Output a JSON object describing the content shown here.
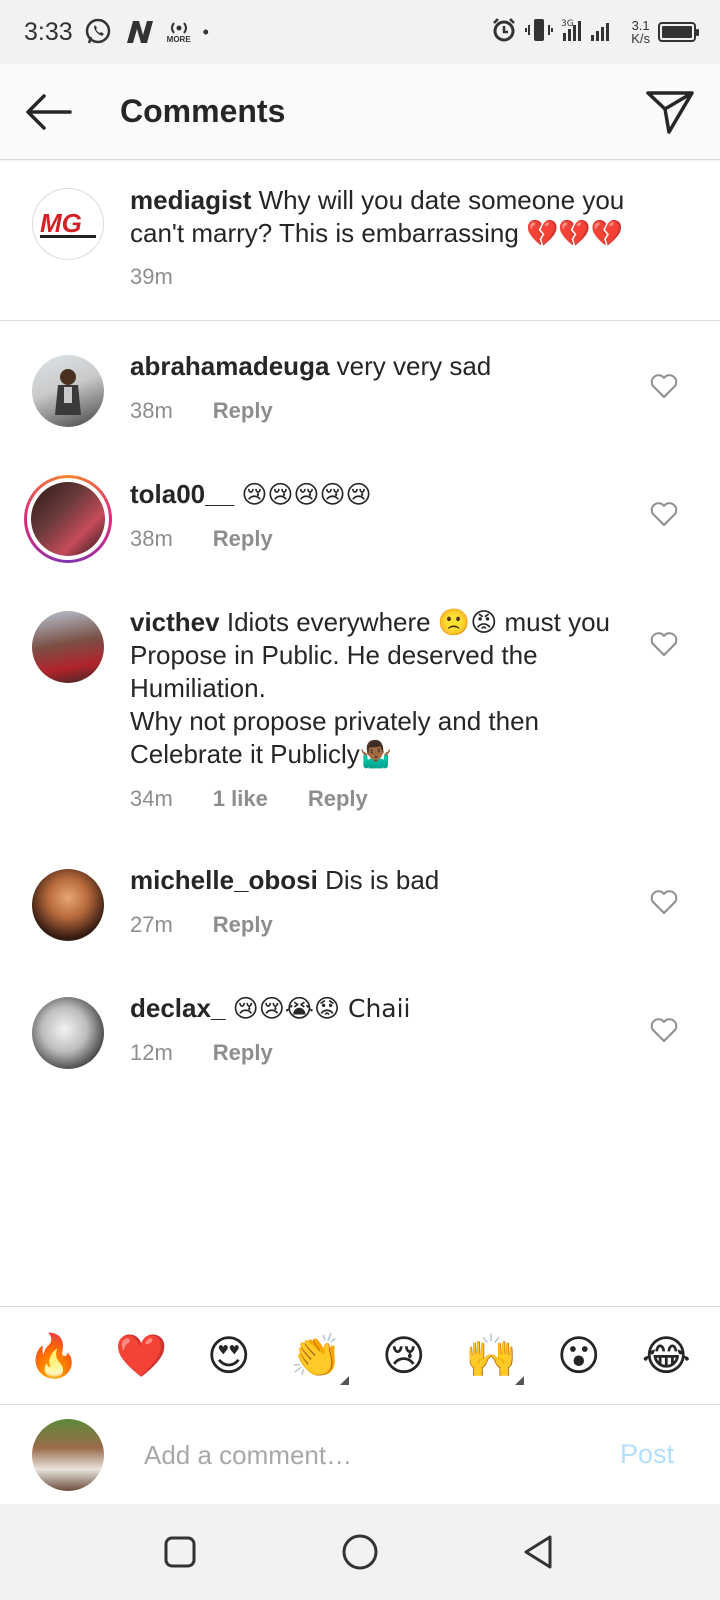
{
  "status_bar": {
    "time": "3:33",
    "net_speed_value": "3.1",
    "net_speed_unit": "K/s",
    "more_label": "MORE",
    "icons": [
      "whatsapp-icon",
      "n-app-icon",
      "hotspot-icon",
      "dot-icon",
      "alarm-icon",
      "vibrate-icon",
      "signal-icon",
      "battery-icon"
    ]
  },
  "header": {
    "title": "Comments"
  },
  "caption": {
    "username": "mediagist",
    "text": "Why will you date someone you can't marry? This is embarrassing 💔💔💔",
    "time": "39m",
    "avatar_text": "MG"
  },
  "comments": [
    {
      "username": "abrahamadeuga",
      "text": "very very sad",
      "time": "38m",
      "likes": "",
      "reply": "Reply"
    },
    {
      "username": "tola00__",
      "text": "😢😢😢😢😢",
      "time": "38m",
      "likes": "",
      "reply": "Reply",
      "has_story": true
    },
    {
      "username": "victhev",
      "text": "Idiots everywhere 🙁😡 must you Propose in Public. He deserved the Humiliation.",
      "text2": "Why not propose privately and then Celebrate it Publicly🤷🏾‍♂️",
      "time": "34m",
      "likes": "1 like",
      "reply": "Reply"
    },
    {
      "username": "michelle_obosi",
      "text": "Dis is bad",
      "time": "27m",
      "likes": "",
      "reply": "Reply"
    },
    {
      "username": "declax_",
      "text": "😢😢😭😟 Chaii",
      "time": "12m",
      "likes": "",
      "reply": "Reply"
    }
  ],
  "reactions": [
    "🔥",
    "❤️",
    "😍",
    "👏",
    "😢",
    "🙌",
    "😮",
    "😂"
  ],
  "composer": {
    "placeholder": "Add a comment…",
    "post_label": "Post"
  },
  "colors": {
    "accent_post": "#b2dffc",
    "meta_gray": "#8e8e8e",
    "divider": "#dbdbdb"
  }
}
